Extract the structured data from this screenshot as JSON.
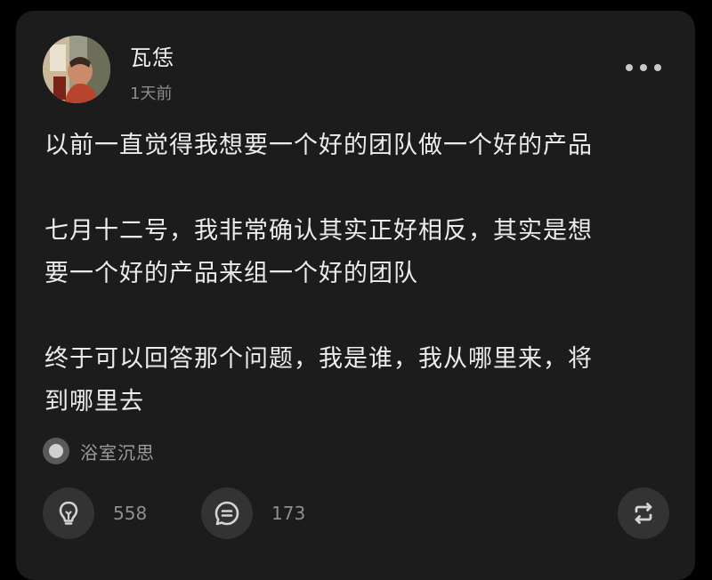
{
  "post": {
    "author": {
      "name": "瓦恁",
      "time": "1天前"
    },
    "paragraphs": {
      "p1": [
        "以前一直觉得我想要一个好的团队做一个好的产品"
      ],
      "p2": [
        "七月十二号，我非常确认其实正好相反，其实是想",
        "要一个好的产品来组一个好的团队"
      ],
      "p3": [
        "终于可以回答那个问题，我是谁，我从哪里来，将",
        "到哪里去"
      ]
    },
    "topic": "浴室沉思",
    "actions": {
      "like_count": "558",
      "comment_count": "173"
    }
  },
  "icons": {
    "more": "more-horizontal-icon",
    "topic": "topic-dot-icon",
    "like": "lightbulb-icon",
    "comment": "comment-lines-icon",
    "repost": "repost-icon"
  }
}
